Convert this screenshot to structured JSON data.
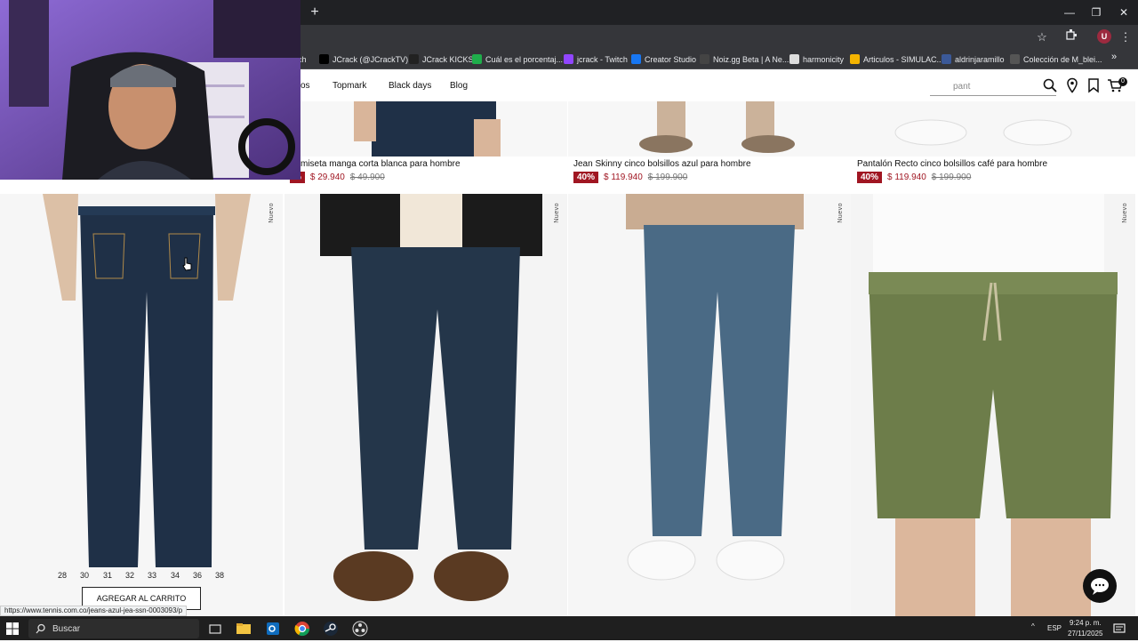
{
  "browser": {
    "new_tab_label": "+",
    "window_controls": [
      "—",
      "❐",
      "✕"
    ],
    "bookmarks": [
      {
        "label": "ch",
        "color": "#35363a"
      },
      {
        "label": "JCrack (@JCrackTV)...",
        "color": "#000000"
      },
      {
        "label": "JCrack KICKS",
        "color": "#222222"
      },
      {
        "label": "Cuál es el porcentaj...",
        "color": "#1fae4b"
      },
      {
        "label": "jcrack - Twitch",
        "color": "#9146ff"
      },
      {
        "label": "Creator Studio",
        "color": "#1877f2"
      },
      {
        "label": "Noiz.gg Beta | A Ne...",
        "color": "#444444"
      },
      {
        "label": "harmonicity",
        "color": "#dddddd"
      },
      {
        "label": "Articulos - SIMULAC...",
        "color": "#f4b400"
      },
      {
        "label": "aldrinjaramillo",
        "color": "#3b5998"
      },
      {
        "label": "Colección de M_blei...",
        "color": "#555555"
      }
    ],
    "bookmarks_more": "»",
    "status_url": "https://www.tennis.com.co/jeans-azul-jea-ssn-0003093/p"
  },
  "site": {
    "nav": [
      "os",
      "Topmark",
      "Black days",
      "Blog"
    ],
    "search": {
      "value": "pant"
    },
    "cart_count": "0",
    "top_products": [
      {
        "name": "miseta manga corta blanca para hombre",
        "discount": "%",
        "price": "$ 29.940",
        "old_price": "$ 49.900"
      },
      {
        "name": "Jean Skinny cinco bolsillos azul para hombre",
        "discount": "40%",
        "price": "$ 119.940",
        "old_price": "$ 199.900"
      },
      {
        "name": "Pantalón Recto cinco bolsillos café para hombre",
        "discount": "40%",
        "price": "$ 119.940",
        "old_price": "$ 199.900"
      }
    ],
    "badge_nuevo": "Nuevo",
    "sizes": [
      "28",
      "30",
      "31",
      "32",
      "33",
      "34",
      "36",
      "38"
    ],
    "add_to_cart": "AGREGAR AL CARRITO"
  },
  "taskbar": {
    "search_label": "Buscar",
    "language": "ESP",
    "time": "9:24 p. m.",
    "date": "27/11/2025"
  },
  "colors": {
    "discount_red": "#a01622",
    "dark_denim": "#1f3047",
    "mid_denim": "#4a6a85",
    "olive_short": "#6d7d4a"
  }
}
